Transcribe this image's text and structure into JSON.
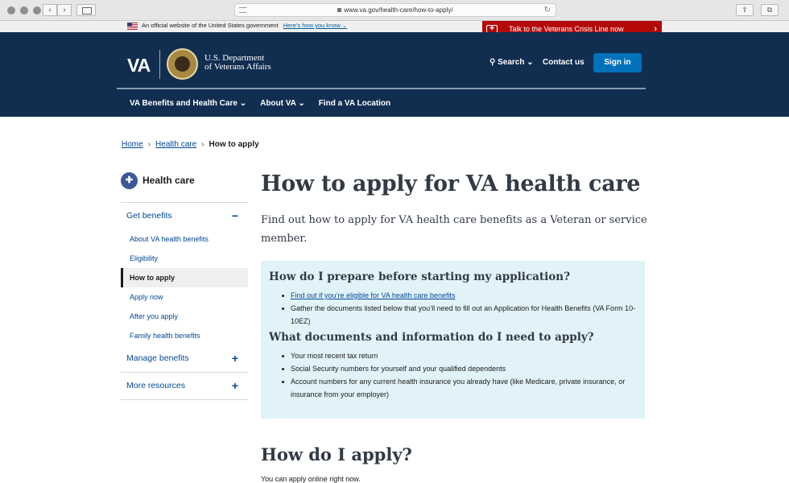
{
  "browser": {
    "url": "www.va.gov/health-care/how-to-apply/"
  },
  "gov_banner": {
    "text": "An official website of the United States government",
    "link": "Here’s how you know"
  },
  "crisis_line": {
    "text": "Talk to the Veterans Crisis Line now"
  },
  "header": {
    "logo": "VA",
    "dept_line1": "U.S. Department",
    "dept_line2": "of Veterans Affairs",
    "search": "Search",
    "contact": "Contact us",
    "sign_in": "Sign in",
    "nav": [
      "VA Benefits and Health Care",
      "About VA",
      "Find a VA Location"
    ]
  },
  "breadcrumb": {
    "home": "Home",
    "health_care": "Health care",
    "current": "How to apply"
  },
  "sidenav": {
    "title": "Health care",
    "get_benefits": "Get benefits",
    "items": [
      "About VA health benefits",
      "Eligibility",
      "How to apply",
      "Apply now",
      "After you apply",
      "Family health benefits"
    ],
    "manage_benefits": "Manage benefits",
    "more_resources": "More resources"
  },
  "main": {
    "title": "How to apply for VA health care",
    "lead": "Find out how to apply for VA health care benefits as a Veteran or service member.",
    "box": {
      "q1": "How do I prepare before starting my application?",
      "q1_link": "Find out if you’re eligible for VA health care benefits",
      "q1_item2": "Gather the documents listed below that you’ll need to fill out an Application for Health Benefits (VA Form 10-10EZ)",
      "q2": "What documents and information do I need to apply?",
      "q2_items": [
        "Your most recent tax return",
        "Social Security numbers for yourself and your qualified dependents",
        "Account numbers for any current health insurance you already have (like Medicare, private insurance, or insurance from your employer)"
      ]
    },
    "how_apply": "How do I apply?",
    "cut_text": "You can apply online right now."
  }
}
